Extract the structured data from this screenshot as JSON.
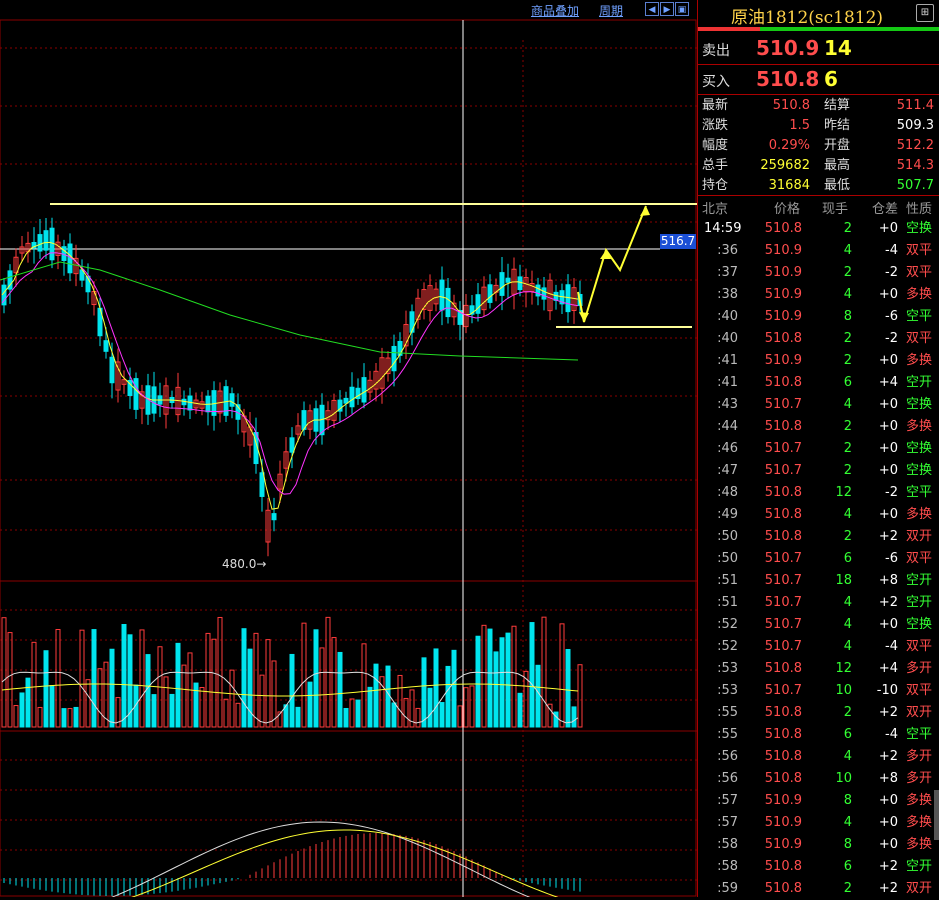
{
  "toolbar": {
    "overlay_label": "商品叠加",
    "period_label": "周期",
    "nav_icons": [
      "arrow-left-icon",
      "arrow-right-icon",
      "expand-icon"
    ]
  },
  "chart": {
    "current_price_label": "516.7",
    "low_label": "480.0→",
    "colors": {
      "up": "#ff3b3b",
      "down": "#00e5ee",
      "ma1": "#ffff33",
      "ma2": "#ff33ff",
      "ma3": "#22dd22",
      "grid": "#8a0000",
      "crosshair": "#ffffff"
    }
  },
  "panel": {
    "title": "原油1812(sc1812)",
    "sell": {
      "label": "卖出",
      "price": "510.9",
      "qty": "14"
    },
    "buy": {
      "label": "买入",
      "price": "510.8",
      "qty": "6"
    },
    "stats": [
      {
        "label": "最新",
        "value": "510.8",
        "color": "#ff4d4d"
      },
      {
        "label": "结算",
        "value": "511.4",
        "color": "#ff4d4d"
      },
      {
        "label": "涨跌",
        "value": "1.5",
        "color": "#ff4d4d"
      },
      {
        "label": "昨结",
        "value": "509.3",
        "color": "#ffffff"
      },
      {
        "label": "幅度",
        "value": "0.29%",
        "color": "#ff4d4d"
      },
      {
        "label": "开盘",
        "value": "512.2",
        "color": "#ff4d4d"
      },
      {
        "label": "总手",
        "value": "259682",
        "color": "#ffff33"
      },
      {
        "label": "最高",
        "value": "514.3",
        "color": "#ff4d4d"
      },
      {
        "label": "持仓",
        "value": "31684",
        "color": "#ffff33"
      },
      {
        "label": "最低",
        "value": "507.7",
        "color": "#33ff33"
      }
    ],
    "headers": [
      "北京",
      "价格",
      "现手",
      "仓差",
      "性质"
    ],
    "trades": [
      {
        "time": "14:59",
        "price": "510.8",
        "vol": "2",
        "oi": "+0",
        "type": "空换"
      },
      {
        "time": ":36",
        "price": "510.9",
        "vol": "4",
        "oi": "-4",
        "type": "双平"
      },
      {
        "time": ":37",
        "price": "510.9",
        "vol": "2",
        "oi": "-2",
        "type": "双平"
      },
      {
        "time": ":38",
        "price": "510.9",
        "vol": "4",
        "oi": "+0",
        "type": "多换"
      },
      {
        "time": ":40",
        "price": "510.9",
        "vol": "8",
        "oi": "-6",
        "type": "空平"
      },
      {
        "time": ":40",
        "price": "510.8",
        "vol": "2",
        "oi": "-2",
        "type": "双平"
      },
      {
        "time": ":41",
        "price": "510.9",
        "vol": "2",
        "oi": "+0",
        "type": "多换"
      },
      {
        "time": ":41",
        "price": "510.8",
        "vol": "6",
        "oi": "+4",
        "type": "空开"
      },
      {
        "time": ":43",
        "price": "510.7",
        "vol": "4",
        "oi": "+0",
        "type": "空换"
      },
      {
        "time": ":44",
        "price": "510.8",
        "vol": "2",
        "oi": "+0",
        "type": "多换"
      },
      {
        "time": ":46",
        "price": "510.7",
        "vol": "2",
        "oi": "+0",
        "type": "空换"
      },
      {
        "time": ":47",
        "price": "510.7",
        "vol": "2",
        "oi": "+0",
        "type": "空换"
      },
      {
        "time": ":48",
        "price": "510.8",
        "vol": "12",
        "oi": "-2",
        "type": "空平"
      },
      {
        "time": ":49",
        "price": "510.8",
        "vol": "4",
        "oi": "+0",
        "type": "多换"
      },
      {
        "time": ":50",
        "price": "510.8",
        "vol": "2",
        "oi": "+2",
        "type": "双开"
      },
      {
        "time": ":50",
        "price": "510.7",
        "vol": "6",
        "oi": "-6",
        "type": "双平"
      },
      {
        "time": ":51",
        "price": "510.7",
        "vol": "18",
        "oi": "+8",
        "type": "空开"
      },
      {
        "time": ":51",
        "price": "510.7",
        "vol": "4",
        "oi": "+2",
        "type": "空开"
      },
      {
        "time": ":52",
        "price": "510.7",
        "vol": "4",
        "oi": "+0",
        "type": "空换"
      },
      {
        "time": ":52",
        "price": "510.7",
        "vol": "4",
        "oi": "-4",
        "type": "双平"
      },
      {
        "time": ":53",
        "price": "510.8",
        "vol": "12",
        "oi": "+4",
        "type": "多开"
      },
      {
        "time": ":53",
        "price": "510.7",
        "vol": "10",
        "oi": "-10",
        "type": "双平"
      },
      {
        "time": ":55",
        "price": "510.8",
        "vol": "2",
        "oi": "+2",
        "type": "双开"
      },
      {
        "time": ":55",
        "price": "510.8",
        "vol": "6",
        "oi": "-4",
        "type": "空平"
      },
      {
        "time": ":56",
        "price": "510.8",
        "vol": "4",
        "oi": "+2",
        "type": "多开"
      },
      {
        "time": ":56",
        "price": "510.8",
        "vol": "10",
        "oi": "+8",
        "type": "多开"
      },
      {
        "time": ":57",
        "price": "510.9",
        "vol": "8",
        "oi": "+0",
        "type": "多换"
      },
      {
        "time": ":57",
        "price": "510.9",
        "vol": "4",
        "oi": "+0",
        "type": "多换"
      },
      {
        "time": ":58",
        "price": "510.9",
        "vol": "8",
        "oi": "+0",
        "type": "多换"
      },
      {
        "time": ":58",
        "price": "510.8",
        "vol": "6",
        "oi": "+2",
        "type": "空开"
      },
      {
        "time": ":59",
        "price": "510.8",
        "vol": "2",
        "oi": "+2",
        "type": "双开"
      }
    ]
  }
}
